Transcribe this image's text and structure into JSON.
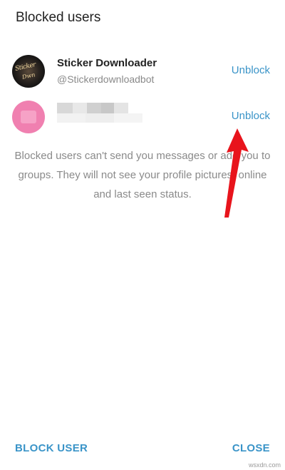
{
  "dialog": {
    "title": "Blocked users",
    "users": [
      {
        "name": "Sticker Downloader",
        "handle": "@Stickerdownloadbot",
        "action": "Unblock",
        "avatar_text_1": "Sticker",
        "avatar_text_2": "Dwn"
      },
      {
        "name": "",
        "handle": "",
        "action": "Unblock"
      }
    ],
    "info": "Blocked users can't send you messages or add you to groups. They will not see your profile pictures, online and last seen status.",
    "block_user": "BLOCK USER",
    "close": "CLOSE"
  },
  "watermark": "wsxdn.com",
  "colors": {
    "accent": "#3a94c8",
    "arrow": "#e8141c",
    "avatar_pink": "#f080b0"
  }
}
